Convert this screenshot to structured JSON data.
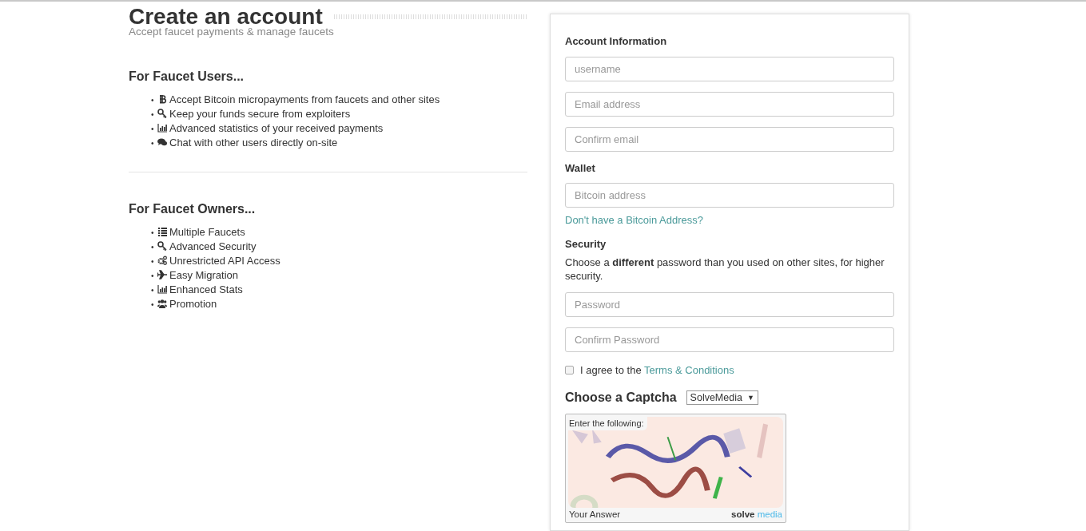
{
  "header": {
    "title": "Create an account",
    "subtitle": "Accept faucet payments & manage faucets"
  },
  "sections": [
    {
      "heading": "For Faucet Users...",
      "items": [
        {
          "marker": "•",
          "kind": "bitcoin",
          "text": "Accept Bitcoin micropayments from faucets and other sites"
        },
        {
          "marker": "•",
          "kind": "key",
          "text": "Keep your funds secure from exploiters"
        },
        {
          "marker": "•",
          "kind": "chart",
          "text": "Advanced statistics of your received payments"
        },
        {
          "marker": "•",
          "kind": "chat",
          "text": "Chat with other users directly on-site"
        }
      ]
    },
    {
      "heading": "For Faucet Owners...",
      "items": [
        {
          "marker": "•",
          "kind": "list",
          "text": "Multiple Faucets"
        },
        {
          "marker": "•",
          "kind": "key",
          "text": "Advanced Security"
        },
        {
          "marker": "•",
          "kind": "gears",
          "text": "Unrestricted API Access"
        },
        {
          "marker": "•",
          "kind": "plane",
          "text": "Easy Migration"
        },
        {
          "marker": "•",
          "kind": "chart",
          "text": "Enhanced Stats"
        },
        {
          "marker": "•",
          "kind": "users",
          "text": "Promotion"
        }
      ]
    }
  ],
  "form": {
    "groups": [
      {
        "heading": "Account Information",
        "fields": [
          {
            "placeholder": "username"
          },
          {
            "placeholder": "Email address"
          },
          {
            "placeholder": "Confirm email"
          }
        ]
      },
      {
        "heading": "Wallet",
        "fields": [
          {
            "placeholder": "Bitcoin address"
          }
        ],
        "link": "Don't have a Bitcoin Address?"
      },
      {
        "heading": "Security",
        "note": "Choose a **different** password than you used on other sites, for higher security.",
        "fields": [
          {
            "placeholder": "Password"
          },
          {
            "placeholder": "Confirm Password"
          }
        ]
      }
    ],
    "agree": {
      "checked": false,
      "text": "I agree to the",
      "link": "Terms & Conditions"
    },
    "captcha": {
      "heading": "Choose a Captcha",
      "selected_option": "SolveMedia",
      "caret": "▼",
      "prompt": "Enter the following:",
      "answer_label": "Your Answer",
      "brand": "solve",
      "brand_accent": "media"
    }
  }
}
